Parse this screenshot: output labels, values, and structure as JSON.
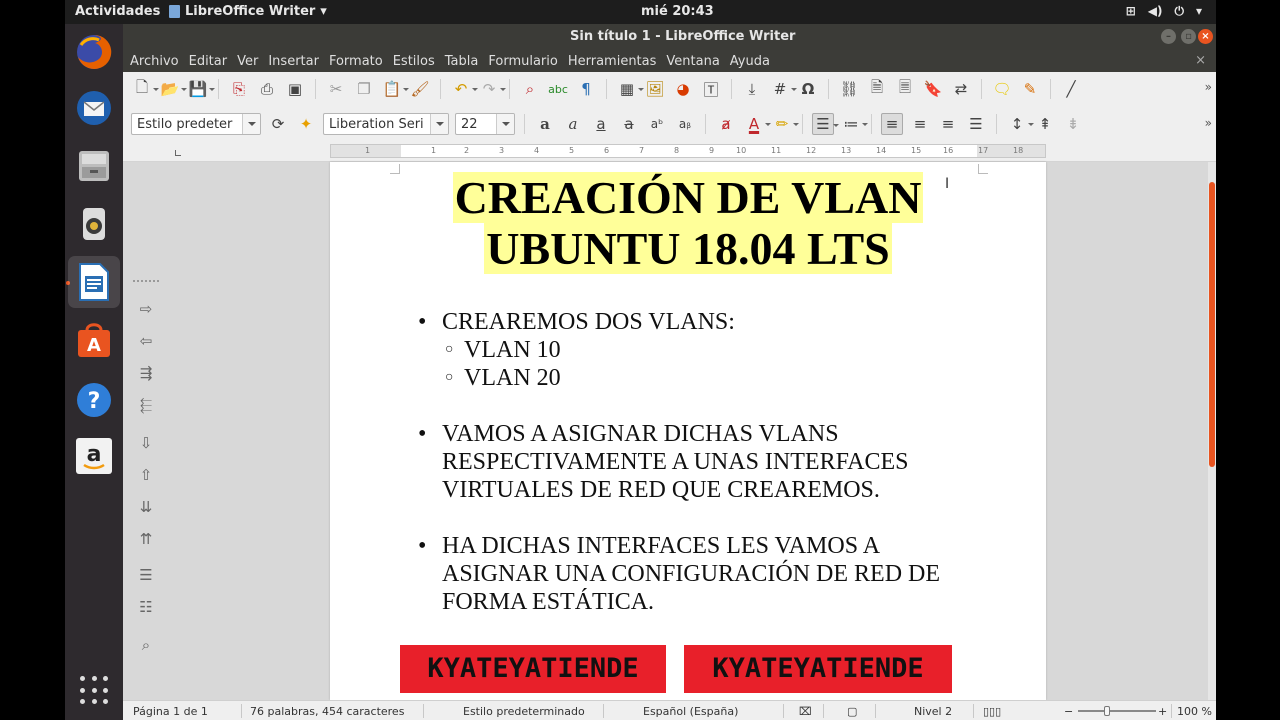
{
  "topbar": {
    "activities": "Actividades",
    "app_name": "LibreOffice Writer",
    "clock": "mié 20:43",
    "tray_icons": [
      "network-icon",
      "volume-icon",
      "power-icon",
      "chevron-down-icon"
    ]
  },
  "dock": {
    "items": [
      {
        "name": "firefox",
        "color": "#e66000"
      },
      {
        "name": "thunderbird",
        "color": "#2f73c6"
      },
      {
        "name": "files",
        "color": "#b9b9b9"
      },
      {
        "name": "rhythmbox",
        "color": "#e0b43a"
      },
      {
        "name": "libreoffice-writer",
        "color": "#2a6fb4"
      },
      {
        "name": "ubuntu-software",
        "color": "#e95420"
      },
      {
        "name": "help",
        "color": "#2f7ed8"
      },
      {
        "name": "amazon",
        "color": "#f2f2f2"
      }
    ]
  },
  "window": {
    "title": "Sin título 1 - LibreOffice Writer"
  },
  "menubar": {
    "items": [
      "Archivo",
      "Editar",
      "Ver",
      "Insertar",
      "Formato",
      "Estilos",
      "Tabla",
      "Formulario",
      "Herramientas",
      "Ventana",
      "Ayuda"
    ],
    "close_doc": "×"
  },
  "toolbar": {
    "paragraph_style": "Estilo predeter",
    "font_name": "Liberation Seri",
    "font_size": "22",
    "more": "»"
  },
  "ruler": {
    "ticks": [
      "1",
      "1",
      "2",
      "3",
      "4",
      "5",
      "6",
      "7",
      "8",
      "9",
      "10",
      "11",
      "12",
      "13",
      "14",
      "15",
      "16",
      "17",
      "18"
    ]
  },
  "document": {
    "title_line1": "CREACIÓN DE VLAN",
    "title_line2": "UBUNTU 18.04 LTS",
    "highlight_color": "#ffff99",
    "bullet1": "CREAREMOS DOS VLANS:",
    "sub1": "VLAN 10",
    "sub2": "VLAN 20",
    "bullet2": "VAMOS A ASIGNAR DICHAS VLANS RESPECTIVAMENTE A UNAS INTERFACES VIRTUALES DE RED QUE CREAREMOS.",
    "bullet3": "HA DICHAS INTERFACES LES VAMOS A ASIGNAR UNA CONFIGURACIÓN DE RED DE FORMA ESTÁTICA.",
    "banner_left": "KYATEYATIENDE",
    "banner_right": "KYATEYATIENDE",
    "banner_color": "#e8202a"
  },
  "statusbar": {
    "page": "Página 1 de 1",
    "words": "76 palabras, 454 caracteres",
    "style": "Estilo predeterminado",
    "language": "Español (España)",
    "level": "Nivel 2",
    "zoom": "100 %",
    "zoom_minus": "−",
    "zoom_plus": "+"
  },
  "theme": {
    "accent": "#e95420"
  }
}
